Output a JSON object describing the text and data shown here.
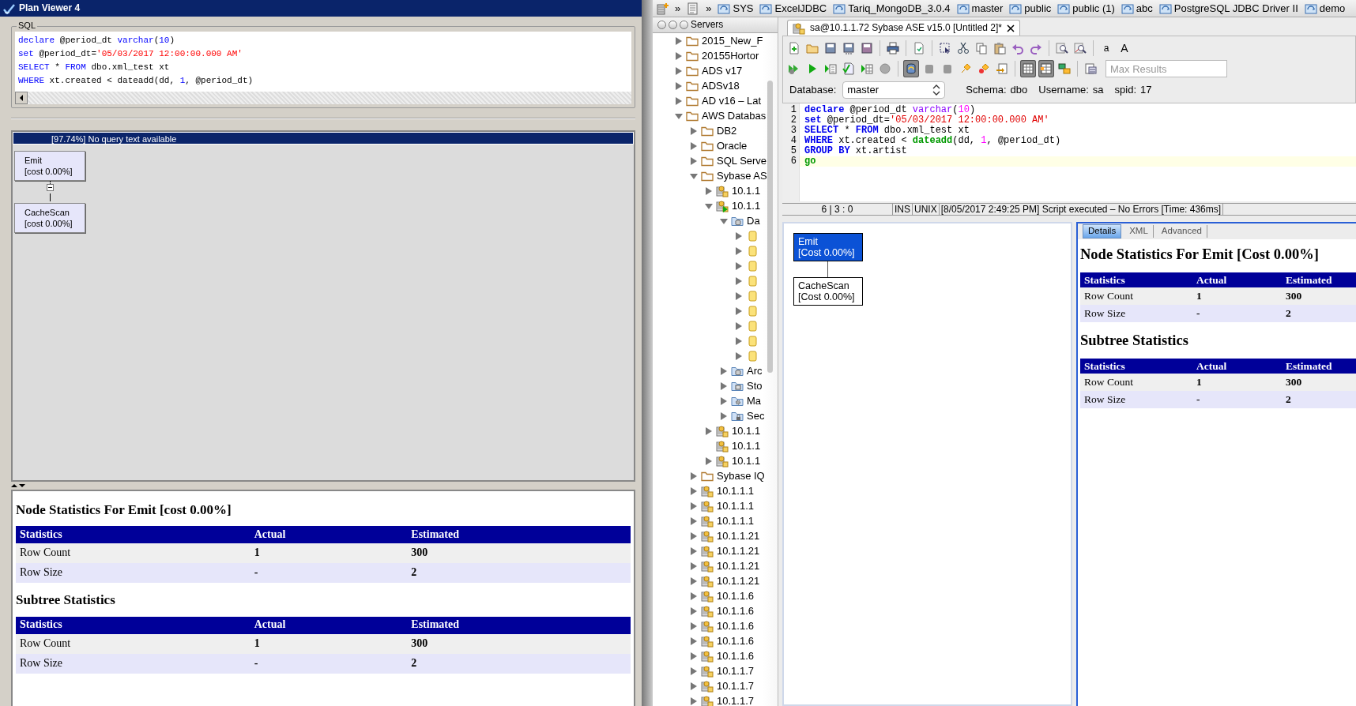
{
  "plan_viewer": {
    "title": "Plan Viewer 4",
    "sql": {
      "legend": "SQL",
      "lines": [
        [
          {
            "text": "declare",
            "kind": "keyword"
          },
          {
            "text": " @period_dt ",
            "kind": "plain"
          },
          {
            "text": "varchar",
            "kind": "type"
          },
          {
            "text": "(",
            "kind": "plain"
          },
          {
            "text": "10",
            "kind": "number"
          },
          {
            "text": ")",
            "kind": "plain"
          }
        ],
        [
          {
            "text": "set",
            "kind": "keyword"
          },
          {
            "text": " @period_dt=",
            "kind": "plain"
          },
          {
            "text": "'05/03/2017 12:00:00.000 AM'",
            "kind": "string"
          }
        ],
        [
          {
            "text": "SELECT",
            "kind": "keyword"
          },
          {
            "text": " * ",
            "kind": "plain"
          },
          {
            "text": "FROM",
            "kind": "keyword"
          },
          {
            "text": " dbo.xml_test xt",
            "kind": "plain"
          }
        ],
        [
          {
            "text": "WHERE",
            "kind": "keyword"
          },
          {
            "text": " xt.created < dateadd(dd, ",
            "kind": "plain"
          },
          {
            "text": "1",
            "kind": "number"
          },
          {
            "text": ", @period_dt)",
            "kind": "plain"
          }
        ]
      ]
    },
    "plan_header": "[97.74%] No query text available",
    "nodes": [
      {
        "name": "Emit",
        "cost": "[cost 0.00%]",
        "expanded": true,
        "children": [
          {
            "name": "CacheScan",
            "cost": "[cost 0.00%]"
          }
        ]
      }
    ],
    "node_stats": {
      "title": "Node Statistics For Emit [cost 0.00%]",
      "columns": [
        "Statistics",
        "Actual",
        "Estimated"
      ],
      "rows": [
        [
          "Row Count",
          "1",
          "300"
        ],
        [
          "Row Size",
          "-",
          "2"
        ]
      ]
    },
    "subtree_stats": {
      "title": "Subtree Statistics",
      "columns": [
        "Statistics",
        "Actual",
        "Estimated"
      ],
      "rows": [
        [
          "Row Count",
          "1",
          "300"
        ],
        [
          "Row Size",
          "-",
          "2"
        ]
      ]
    }
  },
  "bookmarks_bar": {
    "tools": [
      {
        "kind": "new-connection",
        "chevron": "»"
      },
      {
        "kind": "script",
        "chevron": "»"
      }
    ],
    "items": [
      {
        "label": "SYS"
      },
      {
        "label": "ExcelJDBC"
      },
      {
        "label": "Tariq_MongoDB_3.0.4"
      },
      {
        "label": "master"
      },
      {
        "label": "public"
      },
      {
        "label": "public (1)"
      },
      {
        "label": "abc"
      },
      {
        "label": "PostgreSQL JDBC Driver II"
      },
      {
        "label": "demo"
      }
    ]
  },
  "servers_panel": {
    "title": "Servers",
    "tree": [
      {
        "label": "2015_New_F",
        "kind": "folder",
        "expanded": false
      },
      {
        "label": "20155Hortor",
        "kind": "folder",
        "expanded": false
      },
      {
        "label": "ADS v17",
        "kind": "folder",
        "expanded": false
      },
      {
        "label": "ADSv18",
        "kind": "folder",
        "expanded": false
      },
      {
        "label": "AD v16 – Lat",
        "kind": "folder",
        "expanded": false
      },
      {
        "label": "AWS Databas",
        "kind": "folder",
        "expanded": true,
        "children": [
          {
            "label": "DB2",
            "kind": "folder",
            "expanded": false
          },
          {
            "label": "Oracle",
            "kind": "folder",
            "expanded": false
          },
          {
            "label": "SQL Serve",
            "kind": "folder",
            "expanded": false
          },
          {
            "label": "Sybase AS",
            "kind": "folder",
            "expanded": true,
            "children": [
              {
                "label": "10.1.1",
                "kind": "server",
                "expanded": false
              },
              {
                "label": "10.1.1",
                "kind": "server-active",
                "expanded": true,
                "children": [
                  {
                    "label": "Da",
                    "kind": "db-folder",
                    "expanded": true,
                    "children": [
                      {
                        "kind": "database",
                        "expanded": false
                      },
                      {
                        "kind": "database",
                        "expanded": false
                      },
                      {
                        "kind": "database",
                        "expanded": false
                      },
                      {
                        "kind": "database",
                        "expanded": false
                      },
                      {
                        "kind": "database",
                        "expanded": false
                      },
                      {
                        "kind": "database",
                        "expanded": false
                      },
                      {
                        "kind": "database",
                        "expanded": false
                      },
                      {
                        "kind": "database",
                        "expanded": false
                      },
                      {
                        "kind": "database",
                        "expanded": false
                      }
                    ]
                  },
                  {
                    "label": "Arc",
                    "kind": "db-folder",
                    "expanded": false
                  },
                  {
                    "label": "Sto",
                    "kind": "storage",
                    "expanded": false
                  },
                  {
                    "label": "Ma",
                    "kind": "maintenance",
                    "expanded": false
                  },
                  {
                    "label": "Sec",
                    "kind": "security",
                    "expanded": false
                  }
                ]
              },
              {
                "label": "10.1.1",
                "kind": "server",
                "expanded": false
              },
              {
                "label": "10.1.1",
                "kind": "server"
              },
              {
                "label": "10.1.1",
                "kind": "server",
                "expanded": false
              }
            ]
          },
          {
            "label": "Sybase IQ",
            "kind": "folder",
            "expanded": false
          },
          {
            "label": "10.1.1.1",
            "kind": "server",
            "expanded": false
          },
          {
            "label": "10.1.1.1",
            "kind": "server",
            "expanded": false
          },
          {
            "label": "10.1.1.1",
            "kind": "server",
            "expanded": false
          },
          {
            "label": "10.1.1.21",
            "kind": "server",
            "expanded": false
          },
          {
            "label": "10.1.1.21",
            "kind": "server",
            "expanded": false
          },
          {
            "label": "10.1.1.21",
            "kind": "server",
            "expanded": false
          },
          {
            "label": "10.1.1.21",
            "kind": "server",
            "expanded": false
          },
          {
            "label": "10.1.1.6",
            "kind": "server",
            "expanded": false
          },
          {
            "label": "10.1.1.6",
            "kind": "server",
            "expanded": false
          },
          {
            "label": "10.1.1.6",
            "kind": "server",
            "expanded": false
          },
          {
            "label": "10.1.1.6",
            "kind": "server",
            "expanded": false
          },
          {
            "label": "10.1.1.6",
            "kind": "server",
            "expanded": false
          },
          {
            "label": "10.1.1.7",
            "kind": "server",
            "expanded": false
          },
          {
            "label": "10.1.1.7",
            "kind": "server",
            "expanded": false
          },
          {
            "label": "10.1.1.7",
            "kind": "server",
            "expanded": false
          }
        ]
      }
    ]
  },
  "editor": {
    "tab": {
      "title": "sa@10.1.1.72 Sybase ASE v15.0 [Untitled 2]*",
      "selected": true
    },
    "toolbar_rows": [
      [
        {
          "kind": "new"
        },
        {
          "kind": "open"
        },
        {
          "kind": "save"
        },
        {
          "kind": "save-as"
        },
        {
          "kind": "save-all"
        },
        {
          "kind": "separator"
        },
        {
          "kind": "print"
        },
        {
          "kind": "separator"
        },
        {
          "kind": "import"
        },
        {
          "kind": "separator"
        },
        {
          "kind": "select"
        },
        {
          "kind": "cut"
        },
        {
          "kind": "copy"
        },
        {
          "kind": "paste"
        },
        {
          "kind": "undo"
        },
        {
          "kind": "redo"
        },
        {
          "kind": "separator"
        },
        {
          "kind": "find"
        },
        {
          "kind": "find-replace"
        },
        {
          "kind": "separator"
        },
        {
          "kind": "font-smaller",
          "label": "a"
        },
        {
          "kind": "font-larger",
          "label": "A"
        }
      ],
      [
        {
          "kind": "run-all",
          "pressed": false
        },
        {
          "kind": "run",
          "pressed": false
        },
        {
          "kind": "run-step",
          "pressed": false
        },
        {
          "kind": "check",
          "pressed": false
        },
        {
          "kind": "explain",
          "pressed": false
        },
        {
          "kind": "stop",
          "pressed": false
        },
        {
          "kind": "separator"
        },
        {
          "kind": "autocommit",
          "pressed": true
        },
        {
          "kind": "commit",
          "pressed": false
        },
        {
          "kind": "rollback",
          "pressed": false
        },
        {
          "kind": "plug",
          "pressed": false
        },
        {
          "kind": "unplug",
          "pressed": false
        },
        {
          "kind": "export",
          "pressed": false
        },
        {
          "kind": "separator"
        },
        {
          "kind": "grid",
          "pressed": true
        },
        {
          "kind": "grid-tabs",
          "pressed": true
        },
        {
          "kind": "transfer",
          "pressed": false
        },
        {
          "kind": "separator"
        },
        {
          "kind": "history",
          "pressed": false
        }
      ]
    ],
    "max_results": {
      "placeholder": "Max Results"
    },
    "connection": {
      "database_label": "Database:",
      "database": "master",
      "schema_label": "Schema:",
      "schema": "dbo",
      "username_label": "Username:",
      "username": "sa",
      "spid_label": "spid:",
      "spid": "17"
    },
    "lines": [
      {
        "number": "1",
        "current": false,
        "tokens": [
          {
            "text": "declare",
            "kind": "keyword"
          },
          {
            "text": " @period_dt ",
            "kind": "plain"
          },
          {
            "text": "varchar",
            "kind": "type"
          },
          {
            "text": "(",
            "kind": "plain"
          },
          {
            "text": "10",
            "kind": "number"
          },
          {
            "text": ")",
            "kind": "plain"
          }
        ]
      },
      {
        "number": "2",
        "current": false,
        "tokens": [
          {
            "text": "set",
            "kind": "keyword"
          },
          {
            "text": " @period_dt=",
            "kind": "plain"
          },
          {
            "text": "'05/03/2017 12:00:00.000 AM'",
            "kind": "string"
          }
        ]
      },
      {
        "number": "3",
        "current": false,
        "tokens": [
          {
            "text": "SELECT",
            "kind": "keyword"
          },
          {
            "text": " * ",
            "kind": "plain"
          },
          {
            "text": "FROM",
            "kind": "keyword"
          },
          {
            "text": " dbo.xml_test xt",
            "kind": "plain"
          }
        ]
      },
      {
        "number": "4",
        "current": false,
        "tokens": [
          {
            "text": "WHERE",
            "kind": "keyword"
          },
          {
            "text": " xt.created < ",
            "kind": "plain"
          },
          {
            "text": "dateadd",
            "kind": "function"
          },
          {
            "text": "(dd, ",
            "kind": "plain"
          },
          {
            "text": "1",
            "kind": "number"
          },
          {
            "text": ", @period_dt)",
            "kind": "plain"
          }
        ]
      },
      {
        "number": "5",
        "current": false,
        "tokens": [
          {
            "text": "GROUP BY",
            "kind": "keyword"
          },
          {
            "text": " xt.artist",
            "kind": "plain"
          }
        ]
      },
      {
        "number": "6",
        "current": true,
        "tokens": [
          {
            "text": "go",
            "kind": "function"
          }
        ]
      }
    ],
    "status": {
      "position": "6 | 3 : 0",
      "mode": "INS",
      "line_ending": "UNIX",
      "message": "[8/05/2017 2:49:25 PM] Script executed – No Errors [Time: 436ms]"
    }
  },
  "plan": {
    "nodes": [
      {
        "name": "Emit",
        "cost": "[Cost 0.00%]",
        "selected": true,
        "children": [
          {
            "name": "CacheScan",
            "cost": "[Cost 0.00%]",
            "selected": false
          }
        ]
      }
    ],
    "tabs": [
      {
        "label": "Details",
        "selected": true
      },
      {
        "label": "XML",
        "selected": false
      },
      {
        "label": "Advanced",
        "selected": false
      }
    ],
    "node_stats": {
      "title": "Node Statistics For Emit [Cost 0.00%]",
      "columns": [
        "Statistics",
        "Actual",
        "Estimated"
      ],
      "rows": [
        [
          "Row Count",
          "1",
          "300"
        ],
        [
          "Row Size",
          "-",
          "2"
        ]
      ]
    },
    "subtree_stats": {
      "title": "Subtree Statistics",
      "columns": [
        "Statistics",
        "Actual",
        "Estimated"
      ],
      "rows": [
        [
          "Row Count",
          "1",
          "300"
        ],
        [
          "Row Size",
          "-",
          "2"
        ]
      ]
    }
  }
}
